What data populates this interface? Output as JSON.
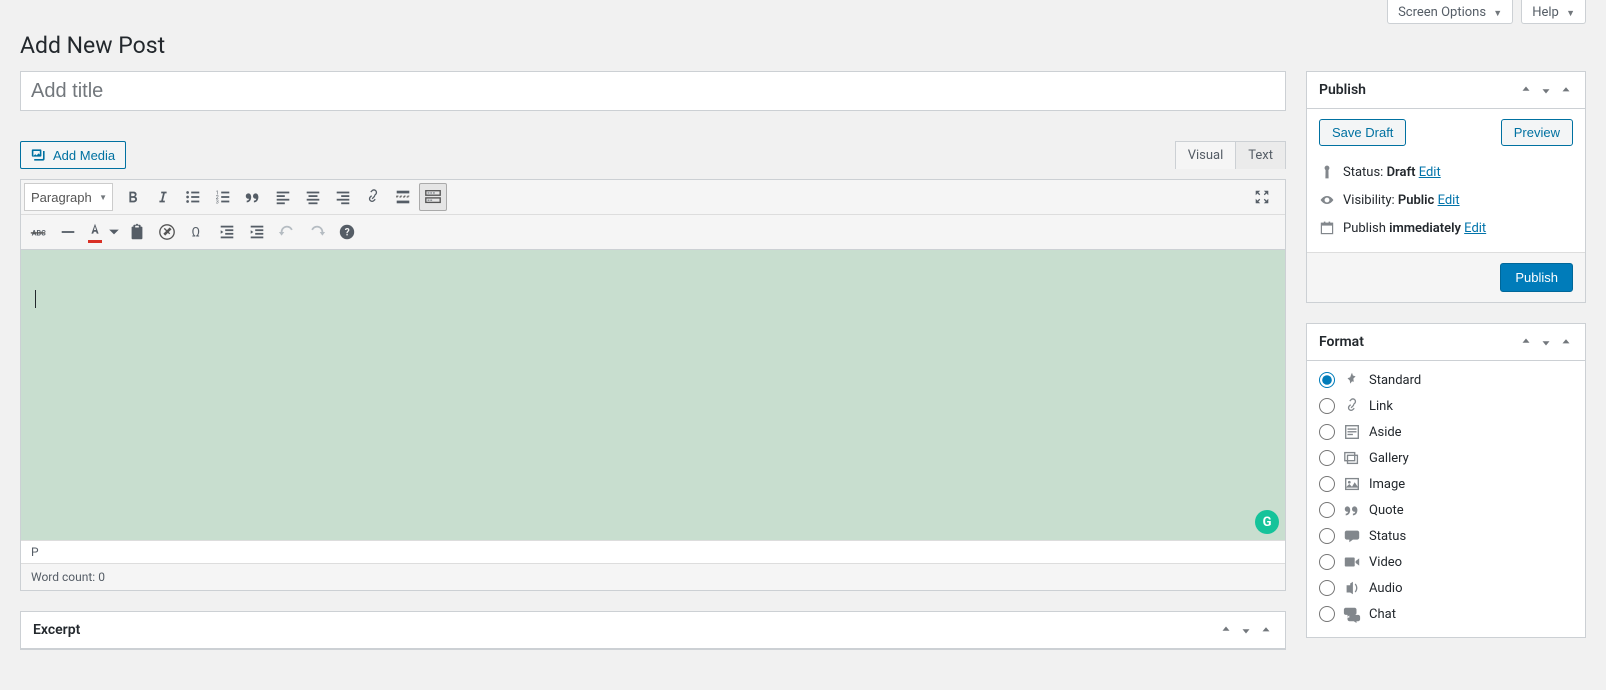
{
  "topbar": {
    "screen_options": "Screen Options",
    "help": "Help"
  },
  "page_title": "Add New Post",
  "title_placeholder": "Add title",
  "media": {
    "add_media": "Add Media"
  },
  "editor_tabs": {
    "visual": "Visual",
    "text": "Text"
  },
  "toolbar": {
    "paragraph": "Paragraph"
  },
  "status_bar": {
    "path": "P",
    "word_count_label": "Word count:",
    "word_count_value": "0"
  },
  "excerpt": {
    "title": "Excerpt"
  },
  "publish": {
    "title": "Publish",
    "save_draft": "Save Draft",
    "preview": "Preview",
    "status_label": "Status:",
    "status_value": "Draft",
    "visibility_label": "Visibility:",
    "visibility_value": "Public",
    "publish_label": "Publish",
    "publish_value": "immediately",
    "edit": "Edit",
    "publish_button": "Publish"
  },
  "format": {
    "title": "Format",
    "items": [
      {
        "label": "Standard",
        "checked": true,
        "icon": "pin"
      },
      {
        "label": "Link",
        "checked": false,
        "icon": "link"
      },
      {
        "label": "Aside",
        "checked": false,
        "icon": "aside"
      },
      {
        "label": "Gallery",
        "checked": false,
        "icon": "gallery"
      },
      {
        "label": "Image",
        "checked": false,
        "icon": "image"
      },
      {
        "label": "Quote",
        "checked": false,
        "icon": "quote"
      },
      {
        "label": "Status",
        "checked": false,
        "icon": "status"
      },
      {
        "label": "Video",
        "checked": false,
        "icon": "video"
      },
      {
        "label": "Audio",
        "checked": false,
        "icon": "audio"
      },
      {
        "label": "Chat",
        "checked": false,
        "icon": "chat"
      }
    ]
  }
}
